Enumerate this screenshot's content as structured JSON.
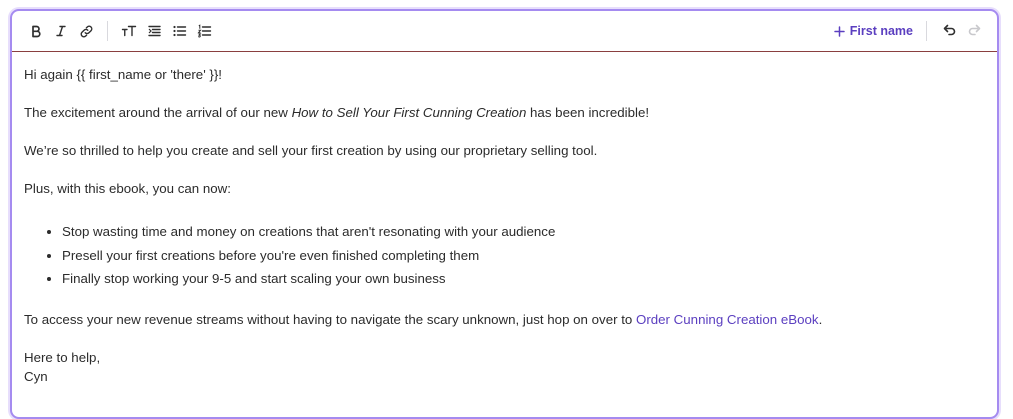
{
  "toolbar": {
    "left_buttons": [
      {
        "name": "bold-button",
        "icon": "bold-icon"
      },
      {
        "name": "italic-button",
        "icon": "italic-icon"
      },
      {
        "name": "link-button",
        "icon": "link-icon"
      },
      {
        "name": "text-size-button",
        "icon": "text-size-icon"
      },
      {
        "name": "align-button",
        "icon": "align-icon"
      },
      {
        "name": "bullet-list-button",
        "icon": "bullet-list-icon"
      },
      {
        "name": "numbered-list-button",
        "icon": "numbered-list-icon"
      }
    ],
    "insert_label": "First name",
    "undo_icon": "undo-icon",
    "redo_icon": "redo-icon"
  },
  "body": {
    "greeting": "Hi again {{ first_name or 'there' }}!",
    "p1_before": "The excitement around the arrival of our new ",
    "p1_title": "How to Sell Your First Cunning Creation",
    "p1_after": " has been incredible!",
    "p2": "We’re so thrilled to help you create and sell your first creation by using our proprietary selling tool.",
    "p3": "Plus, with this ebook, you can now:",
    "bullets": [
      "Stop wasting time and money on creations that aren't resonating with your audience",
      "Presell your first creations before you're even finished completing them",
      "Finally stop working your 9-5 and start scaling your own business"
    ],
    "p4_before": "To access your new revenue streams without having to navigate the scary unknown, just hop on over to ",
    "p4_link": "Order Cunning Creation eBook",
    "p4_after": ".",
    "signoff": "Here to help,",
    "signature": "Cyn"
  },
  "colors": {
    "accent": "#5b3fc0",
    "focus_border": "#a58bf0",
    "toolbar_rule": "#8a3f3f",
    "disabled_icon": "#c8c8cc"
  }
}
